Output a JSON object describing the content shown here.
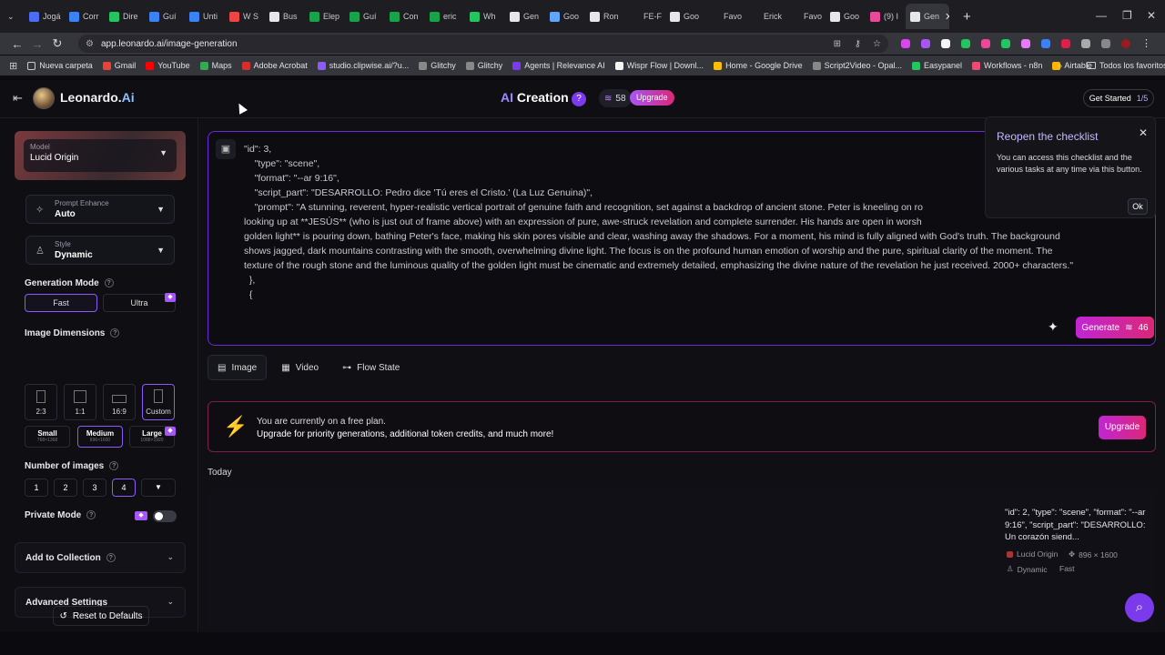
{
  "browser": {
    "tabs": [
      {
        "label": "Jogá",
        "color": "#4a6cf7"
      },
      {
        "label": "Corr",
        "color": "#3b82f6"
      },
      {
        "label": "Dire",
        "color": "#22c55e"
      },
      {
        "label": "Guí",
        "color": "#3b82f6"
      },
      {
        "label": "Unti",
        "color": "#3b82f6"
      },
      {
        "label": "W S",
        "color": "#ef4444"
      },
      {
        "label": "Bus",
        "color": "#e5e7eb"
      },
      {
        "label": "Elep",
        "color": "#16a34a"
      },
      {
        "label": "Guí",
        "color": "#16a34a"
      },
      {
        "label": "Con",
        "color": "#16a34a"
      },
      {
        "label": "eric",
        "color": "#16a34a"
      },
      {
        "label": "Wh",
        "color": "#22c55e"
      },
      {
        "label": "Gen",
        "color": "#e5e7eb"
      },
      {
        "label": "Goo",
        "color": "#60a5fa"
      },
      {
        "label": "Ron",
        "color": "#e5e7eb"
      },
      {
        "label": "FE-F",
        "color": "#1d1d22"
      },
      {
        "label": "Goo",
        "color": "#e5e7eb"
      },
      {
        "label": "Favo",
        "color": "#1d1d22"
      },
      {
        "label": "Erick",
        "color": "#1d1d22"
      },
      {
        "label": "Favo",
        "color": "#1d1d22"
      },
      {
        "label": "Goo",
        "color": "#e5e7eb"
      },
      {
        "label": "(9) I",
        "color": "#ec4899"
      },
      {
        "label": "Gen",
        "color": "#e5e7eb"
      }
    ],
    "active_tab_close": "✕",
    "new_tab": "+",
    "url": "app.leonardo.ai/image-generation",
    "bookmarks": [
      {
        "label": "Nueva carpeta",
        "color": "#ffffff00"
      },
      {
        "label": "Gmail",
        "color": "#ea4335"
      },
      {
        "label": "YouTube",
        "color": "#ff0000"
      },
      {
        "label": "Maps",
        "color": "#34a853"
      },
      {
        "label": "Adobe Acrobat",
        "color": "#d32f2f"
      },
      {
        "label": "studio.clipwise.ai/?u...",
        "color": "#8b5cf6"
      },
      {
        "label": "Glitchy",
        "color": "#888888"
      },
      {
        "label": "Glitchy",
        "color": "#888888"
      },
      {
        "label": "Agents | Relevance AI",
        "color": "#7c3aed"
      },
      {
        "label": "Wispr Flow | Downl...",
        "color": "#f5f5f5"
      },
      {
        "label": "Home - Google Drive",
        "color": "#fbbc04"
      },
      {
        "label": "Script2Video - Opal...",
        "color": "#888888"
      },
      {
        "label": "Easypanel",
        "color": "#22c55e"
      },
      {
        "label": "Workflows - n8n",
        "color": "#ea4b71"
      },
      {
        "label": "Airtable",
        "color": "#fcb400"
      }
    ],
    "all_bookmarks": "Todos los favoritos"
  },
  "header": {
    "app_name_main": "Leonardo.",
    "app_name_ai": "Ai",
    "center_ai": "AI",
    "center_title": "Creation",
    "help": "?",
    "tokens": "58",
    "upgrade": "Upgrade",
    "get_started": "Get Started",
    "get_started_progress": "1/5"
  },
  "sidebar": {
    "model_label": "Model",
    "model_value": "Lucid Origin",
    "prompt_enhance_label": "Prompt Enhance",
    "prompt_enhance_value": "Auto",
    "style_label": "Style",
    "style_value": "Dynamic",
    "generation_mode_title": "Generation Mode",
    "mode_fast": "Fast",
    "mode_ultra": "Ultra",
    "image_dimensions_title": "Image Dimensions",
    "dims": [
      "2:3",
      "1:1",
      "16:9",
      "Custom"
    ],
    "sizes": [
      {
        "label": "Small",
        "sub": "768×1368"
      },
      {
        "label": "Medium",
        "sub": "896×1600"
      },
      {
        "label": "Large",
        "sub": "1088×1920"
      }
    ],
    "number_title": "Number of images",
    "numbers": [
      "1",
      "2",
      "3",
      "4"
    ],
    "private_mode": "Private Mode",
    "add_to_collection": "Add to Collection",
    "advanced_settings": "Advanced Settings",
    "reset": "Reset to Defaults"
  },
  "prompt": {
    "text": "\"id\": 3,\n    \"type\": \"scene\",\n    \"format\": \"--ar 9:16\",\n    \"script_part\": \"DESARROLLO: Pedro dice 'Tú eres el Cristo.' (La Luz Genuina)\",\n    \"prompt\": \"A stunning, reverent, hyper-realistic vertical portrait of genuine faith and recognition, set against a backdrop of ancient stone. Peter is kneeling on ro\nlooking up at **JESÚS** (who is just out of frame above) with an expression of pure, awe-struck revelation and complete surrender. His hands are open in worsh\ngolden light** is pouring down, bathing Peter's face, making his skin pores visible and clear, washing away the shadows. For a moment, his mind is fully aligned with God's truth. The background\nshows jagged, dark mountains contrasting with the smooth, overwhelming divine light. The focus is on the profound human emotion of worship and the pure, spiritual clarity of the moment. The\ntexture of the rough stone and the luminous quality of the golden light must be cinematic and extremely detailed, emphasizing the divine nature of the revelation he just received. 2000+ characters.\"\n  },\n  {",
    "generate_label": "Generate",
    "generate_cost": "46"
  },
  "mode_tabs": [
    "Image",
    "Video",
    "Flow State"
  ],
  "free_plan": {
    "line1": "You are currently on a free plan.",
    "line2": "Upgrade for priority generations, additional token credits, and much more!",
    "button": "Upgrade"
  },
  "gallery": {
    "section": "Today",
    "item_text": "\"id\": 2, \"type\": \"scene\", \"format\": \"--ar 9:16\", \"script_part\": \"DESARROLLO: Un corazón siend...",
    "model": "Lucid Origin",
    "dims": "896 × 1600",
    "style": "Dynamic",
    "speed": "Fast"
  },
  "popover": {
    "title": "Reopen the checklist",
    "body": "You can access this checklist and the various tasks at any time via this button.",
    "ok": "Ok",
    "close": "✕"
  }
}
